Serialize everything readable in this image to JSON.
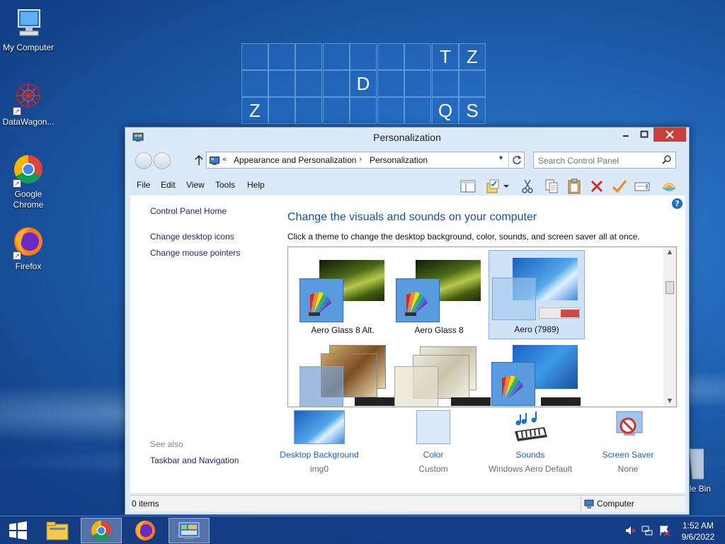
{
  "desktop": {
    "icons": [
      {
        "label": "My Computer",
        "icon": "computer-icon"
      },
      {
        "label": "DataWagon...",
        "icon": "datawagon-icon"
      },
      {
        "label": "Google Chrome",
        "icon": "chrome-icon"
      },
      {
        "label": "Firefox",
        "icon": "firefox-icon"
      }
    ],
    "recycle_bin_label": "le Bin",
    "board_letters": [
      "T",
      "Z",
      "D",
      "Z",
      "Q",
      "S"
    ]
  },
  "window": {
    "title": "Personalization",
    "address": {
      "chevrons": "«",
      "crumb1": "Appearance and Personalization",
      "separator": "›",
      "crumb2": "Personalization"
    },
    "search_placeholder": "Search Control Panel",
    "menu": [
      "File",
      "Edit",
      "View",
      "Tools",
      "Help"
    ],
    "left_pane": {
      "home": "Control Panel Home",
      "links": [
        "Change desktop icons",
        "Change mouse pointers"
      ],
      "see_also": "See also",
      "see_also_links": [
        "Taskbar and Navigation"
      ]
    },
    "main": {
      "title": "Change the visuals and sounds on your computer",
      "subtitle": "Click a theme to change the desktop background, color, sounds, and screen saver all at once.",
      "themes": [
        {
          "label": "Aero Glass 8 Alt.",
          "selected": false
        },
        {
          "label": "Aero Glass 8",
          "selected": false
        },
        {
          "label": "Aero (7989)",
          "selected": true
        }
      ],
      "personalize": [
        {
          "link": "Desktop Background",
          "value": "img0",
          "icon": "desktop-background-icon"
        },
        {
          "link": "Color",
          "value": "Custom",
          "icon": "color-icon"
        },
        {
          "link": "Sounds",
          "value": "Windows Aero Default",
          "icon": "sounds-icon"
        },
        {
          "link": "Screen Saver",
          "value": "None",
          "icon": "screen-saver-icon"
        }
      ]
    },
    "status": {
      "items": "0 items",
      "location": "Computer"
    }
  },
  "taskbar": {
    "time": "1:52 AM",
    "date": "9/6/2022"
  },
  "colors": {
    "accent_link": "#1b62b8",
    "close_button": "#c7413a",
    "title_text": "#1c4f9c"
  }
}
